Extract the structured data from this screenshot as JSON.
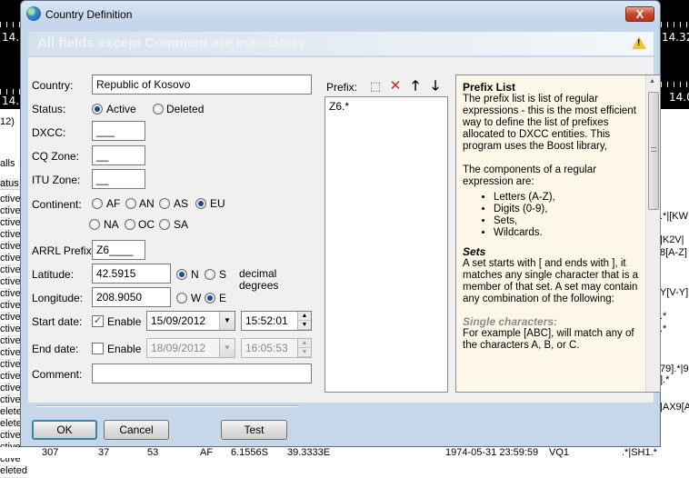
{
  "background": {
    "numbers": [
      "14.",
      "14.32",
      "14.",
      "14.0"
    ],
    "left_header": "12)",
    "left_calls": "alls",
    "left_status": "atus",
    "left_rows": [
      "ctive",
      "ctive",
      "ctive",
      "ctive",
      "ctive",
      "ctive",
      "ctive",
      "ctive",
      "ctive",
      "ctive",
      "ctive",
      "ctive",
      "ctive",
      "ctive",
      "ctive",
      "ctive",
      "ctive",
      "ctive",
      "eleted",
      "elete",
      "ctive",
      "ctive",
      "ctive",
      "eleted"
    ],
    "right_texts": [
      ".*|[KW",
      "|K2V|",
      "8[A-Z]",
      "Y[V-Y]",
      ".*",
      ".*",
      "79].*|9",
      "].*",
      "|AX9[A"
    ],
    "bottom_row": [
      "307",
      "37",
      "53",
      "AF",
      "6.1556S",
      "39.3333E",
      "1974-05-31 23:59:59",
      "VQ1",
      ".*|SH1.*"
    ]
  },
  "dialog": {
    "title": "Country Definition",
    "close_label": "X",
    "banner": "All fields except Comment are mandatory",
    "labels": {
      "country": "Country:",
      "status": "Status:",
      "dxcc": "DXCC:",
      "cq_zone": "CQ Zone:",
      "itu_zone": "ITU Zone:",
      "continent": "Continent:",
      "arrl_prefix": "ARRL Prefix:",
      "latitude": "Latitude:",
      "longitude": "Longitude:",
      "start_date": "Start date:",
      "end_date": "End date:",
      "comment": "Comment:",
      "decimal_degrees": "decimal degrees",
      "prefix": "Prefix:"
    },
    "values": {
      "country": "Republic of Kosovo",
      "dxcc": "___",
      "cq_zone": "__",
      "itu_zone": "__",
      "arrl_prefix": "Z6____",
      "latitude": "42.5915",
      "longitude": "208.9050",
      "start_date": "15/09/2012",
      "start_time": "15:52:01",
      "end_date": "18/09/2012",
      "end_time": "16:05:53",
      "comment": ""
    },
    "status_options": {
      "active": "Active",
      "deleted": "Deleted"
    },
    "continents": [
      "AF",
      "AN",
      "AS",
      "EU",
      "NA",
      "OC",
      "SA"
    ],
    "selected_continent": "EU",
    "lat_dirs": [
      "N",
      "S"
    ],
    "lon_dirs": [
      "W",
      "E"
    ],
    "enable_label": "Enable",
    "prefixes": [
      "Z6.*"
    ],
    "buttons": {
      "ok": "OK",
      "cancel": "Cancel",
      "test": "Test"
    },
    "help": {
      "title": "Prefix List",
      "intro": "The prefix list is list of regular expressions - this is the most efficient way to define the list of prefixes allocated to DXCC entities. This program uses the Boost library,",
      "components_intro": "The components of a regular expression are:",
      "components": [
        "Letters (A-Z),",
        "Digits (0-9),",
        "Sets,",
        "Wildcards."
      ],
      "sets_title": "Sets",
      "sets_text": "A set starts with [ and ends with ], it matches any single character that is a member of that set. A set may contain any combination of the following:",
      "single_title": "Single characters:",
      "single_text": "For example [ABC], will match any of the characters A, B, or C."
    }
  }
}
